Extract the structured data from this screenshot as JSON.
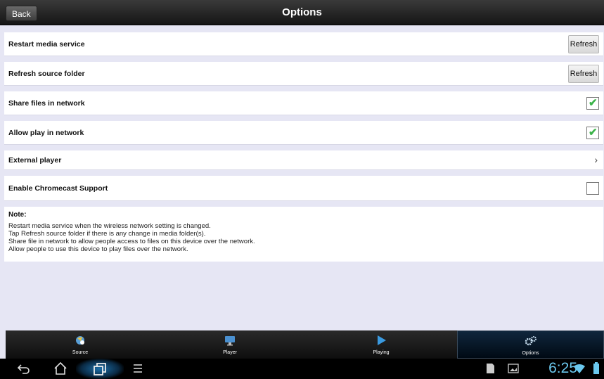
{
  "header": {
    "back_label": "Back",
    "title": "Options"
  },
  "rows": [
    {
      "label": "Restart media service",
      "control": "button",
      "button_label": "Refresh"
    },
    {
      "label": "Refresh source folder",
      "control": "button",
      "button_label": "Refresh"
    },
    {
      "label": "Share files in network",
      "control": "checkbox",
      "checked": true
    },
    {
      "label": "Allow play in network",
      "control": "checkbox",
      "checked": true
    },
    {
      "label": "External player",
      "control": "chevron"
    },
    {
      "label": "Enable Chromecast Support",
      "control": "checkbox",
      "checked": false
    }
  ],
  "note": {
    "title": "Note:",
    "lines": [
      "Restart media service when the wireless network setting is changed.",
      "Tap Refresh source folder if there is any change in media folder(s).",
      "Share file in network to allow people access to files on this device over the network.",
      "Allow people to use this device to play files over the network."
    ]
  },
  "tabs": [
    {
      "label": "Source",
      "icon": "source-icon",
      "active": false
    },
    {
      "label": "Player",
      "icon": "monitor-icon",
      "active": false
    },
    {
      "label": "Playing",
      "icon": "play-icon",
      "active": false
    },
    {
      "label": "Options",
      "icon": "gears-icon",
      "active": true
    }
  ],
  "system_bar": {
    "time": "6:25",
    "icons": [
      "back-icon",
      "home-icon",
      "recent-apps-icon",
      "menu-icon",
      "sd-card-icon",
      "gallery-icon",
      "wifi-icon",
      "battery-icon"
    ]
  },
  "colors": {
    "check": "#3cb34a",
    "clock": "#6bc8ee",
    "background": "#e6e6f4"
  }
}
